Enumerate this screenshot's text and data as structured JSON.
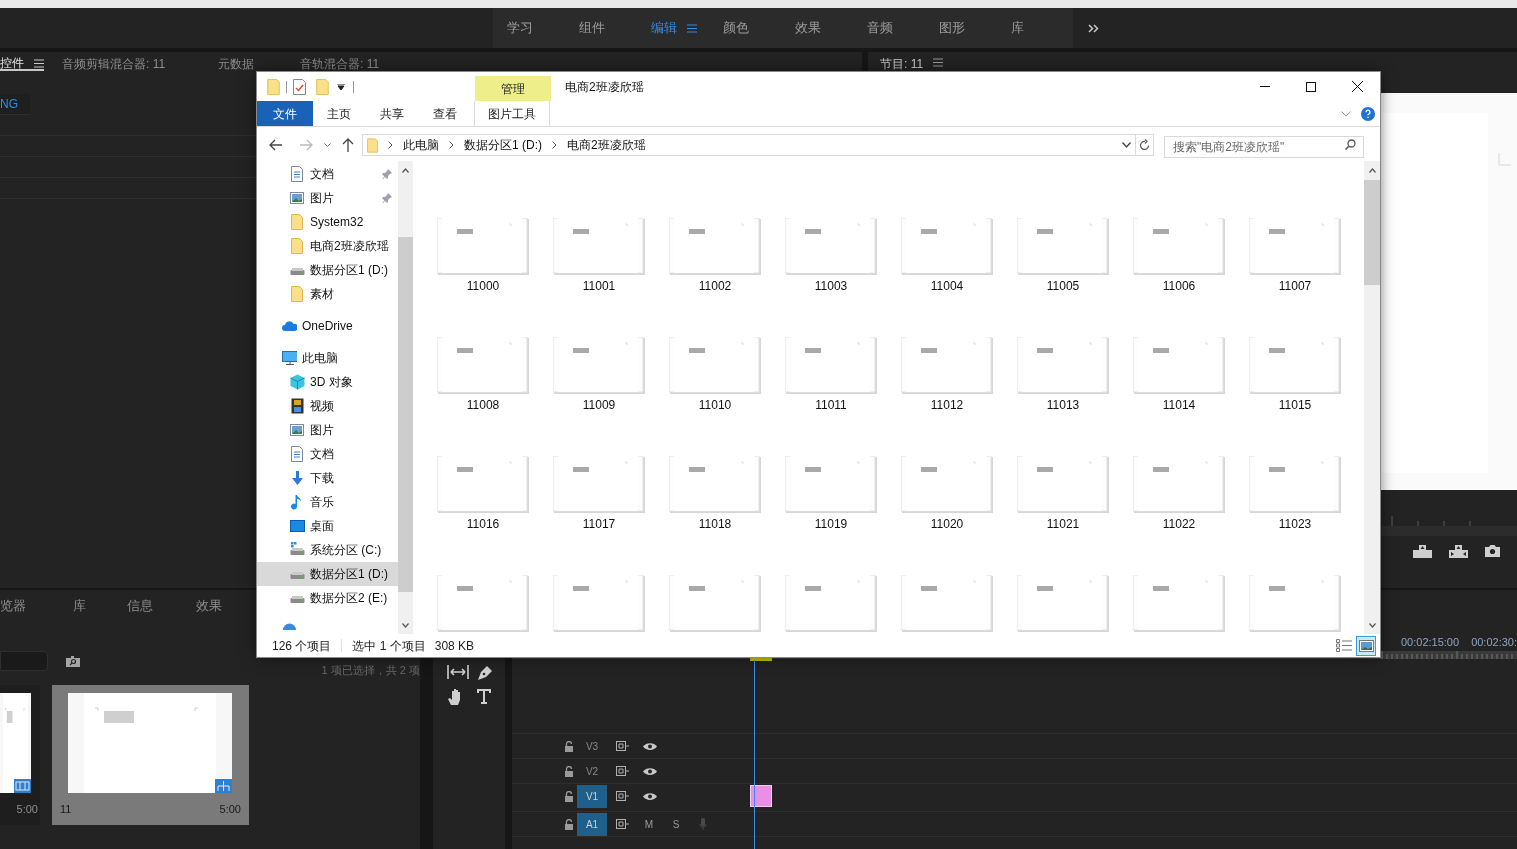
{
  "workspace_tabs": [
    {
      "label": "学习",
      "selected": false
    },
    {
      "label": "组件",
      "selected": false
    },
    {
      "label": "编辑",
      "selected": true
    },
    {
      "label": "颜色",
      "selected": false
    },
    {
      "label": "效果",
      "selected": false
    },
    {
      "label": "音频",
      "selected": false
    },
    {
      "label": "图形",
      "selected": false
    },
    {
      "label": "库",
      "selected": false
    }
  ],
  "source_panel": {
    "tabs": [
      {
        "label": "控件",
        "selected": true
      },
      {
        "label": "音频剪辑混合器: 11",
        "selected": false
      },
      {
        "label": "元数据",
        "selected": false
      },
      {
        "label": "音轨混合器: 11",
        "selected": false
      }
    ],
    "row_label": "NG"
  },
  "program_panel": {
    "tab": "节目: 11"
  },
  "project_panel": {
    "tabs": [
      "览器",
      "库",
      "信息",
      "效果"
    ],
    "selection_info": "1 项已选择，共 2 项",
    "items": [
      {
        "kind": "video",
        "duration": "5:00",
        "selected": false
      },
      {
        "kind": "sequence",
        "name": "11",
        "duration": "5:00",
        "selected": true
      }
    ]
  },
  "timeline": {
    "timecodes": [
      "00:02:15:00",
      "00:02:30:"
    ],
    "tracks": [
      {
        "kind": "video",
        "label": "V3",
        "targeted": false,
        "clip": false
      },
      {
        "kind": "video",
        "label": "V2",
        "targeted": false,
        "clip": false
      },
      {
        "kind": "video",
        "label": "V1",
        "targeted": true,
        "clip": true
      },
      {
        "kind": "audio",
        "label": "A1",
        "targeted": true,
        "clip": false,
        "mute": "M",
        "solo": "S"
      }
    ]
  },
  "explorer": {
    "title": "电商2班凌欣瑶",
    "context_tab": "管理",
    "ribbon_tabs": [
      {
        "label": "文件",
        "kind": "file"
      },
      {
        "label": "主页",
        "kind": "tab"
      },
      {
        "label": "共享",
        "kind": "tab"
      },
      {
        "label": "查看",
        "kind": "tab"
      },
      {
        "label": "图片工具",
        "kind": "context"
      }
    ],
    "path": [
      "此电脑",
      "数据分区1 (D:)",
      "电商2班凌欣瑶"
    ],
    "search_placeholder": "搜索\"电商2班凌欣瑶\"",
    "quick_access": [
      {
        "label": "文档",
        "kind": "document",
        "pinned": true,
        "selected": false
      },
      {
        "label": "图片",
        "kind": "pictures",
        "pinned": true,
        "selected": false
      },
      {
        "label": "System32",
        "kind": "folder",
        "pinned": false,
        "selected": false
      },
      {
        "label": "电商2班凌欣瑶",
        "kind": "folder",
        "pinned": false,
        "selected": false
      },
      {
        "label": "数据分区1 (D:)",
        "kind": "drive",
        "pinned": false,
        "selected": false
      },
      {
        "label": "素材",
        "kind": "folder",
        "pinned": false,
        "selected": false
      }
    ],
    "nav_roots": [
      {
        "label": "OneDrive",
        "kind": "cloud",
        "selected": false
      },
      {
        "label": "此电脑",
        "kind": "pc",
        "selected": false,
        "children": [
          {
            "label": "3D 对象",
            "kind": "cube",
            "selected": false
          },
          {
            "label": "视频",
            "kind": "videos",
            "selected": false
          },
          {
            "label": "图片",
            "kind": "pictures",
            "selected": false
          },
          {
            "label": "文档",
            "kind": "document",
            "selected": false
          },
          {
            "label": "下载",
            "kind": "download",
            "selected": false
          },
          {
            "label": "音乐",
            "kind": "music",
            "selected": false
          },
          {
            "label": "桌面",
            "kind": "desktop",
            "selected": false
          },
          {
            "label": "系统分区 (C:)",
            "kind": "system-drive",
            "selected": false
          },
          {
            "label": "数据分区1 (D:)",
            "kind": "drive",
            "selected": true
          },
          {
            "label": "数据分区2 (E:)",
            "kind": "drive",
            "selected": false
          }
        ]
      },
      {
        "kind": "network",
        "selected": false
      }
    ],
    "files": [
      {
        "kind": "picture",
        "name": "11000"
      },
      {
        "kind": "picture",
        "name": "11001"
      },
      {
        "kind": "picture",
        "name": "11002"
      },
      {
        "kind": "picture",
        "name": "11003"
      },
      {
        "kind": "picture",
        "name": "11004"
      },
      {
        "kind": "picture",
        "name": "11005"
      },
      {
        "kind": "picture",
        "name": "11006"
      },
      {
        "kind": "picture",
        "name": "11007"
      },
      {
        "kind": "picture",
        "name": "11008"
      },
      {
        "kind": "picture",
        "name": "11009"
      },
      {
        "kind": "picture",
        "name": "11010"
      },
      {
        "kind": "picture",
        "name": "11011"
      },
      {
        "kind": "picture",
        "name": "11012"
      },
      {
        "kind": "picture",
        "name": "11013"
      },
      {
        "kind": "picture",
        "name": "11014"
      },
      {
        "kind": "picture",
        "name": "11015"
      },
      {
        "kind": "picture",
        "name": "11016"
      },
      {
        "kind": "picture",
        "name": "11017"
      },
      {
        "kind": "picture",
        "name": "11018"
      },
      {
        "kind": "picture",
        "name": "11019"
      },
      {
        "kind": "picture",
        "name": "11020"
      },
      {
        "kind": "picture",
        "name": "11021"
      },
      {
        "kind": "picture",
        "name": "11022"
      },
      {
        "kind": "picture",
        "name": "11023"
      },
      {
        "kind": "picture"
      },
      {
        "kind": "picture"
      },
      {
        "kind": "picture"
      },
      {
        "kind": "picture"
      },
      {
        "kind": "picture"
      },
      {
        "kind": "picture"
      },
      {
        "kind": "picture"
      },
      {
        "kind": "picture"
      }
    ],
    "status": {
      "count": "126 个项目",
      "selection": "选中 1 个项目",
      "size": "308 KB"
    },
    "view_buttons": [
      {
        "kind": "details",
        "selected": false
      },
      {
        "kind": "large-icons",
        "selected": true
      }
    ]
  }
}
